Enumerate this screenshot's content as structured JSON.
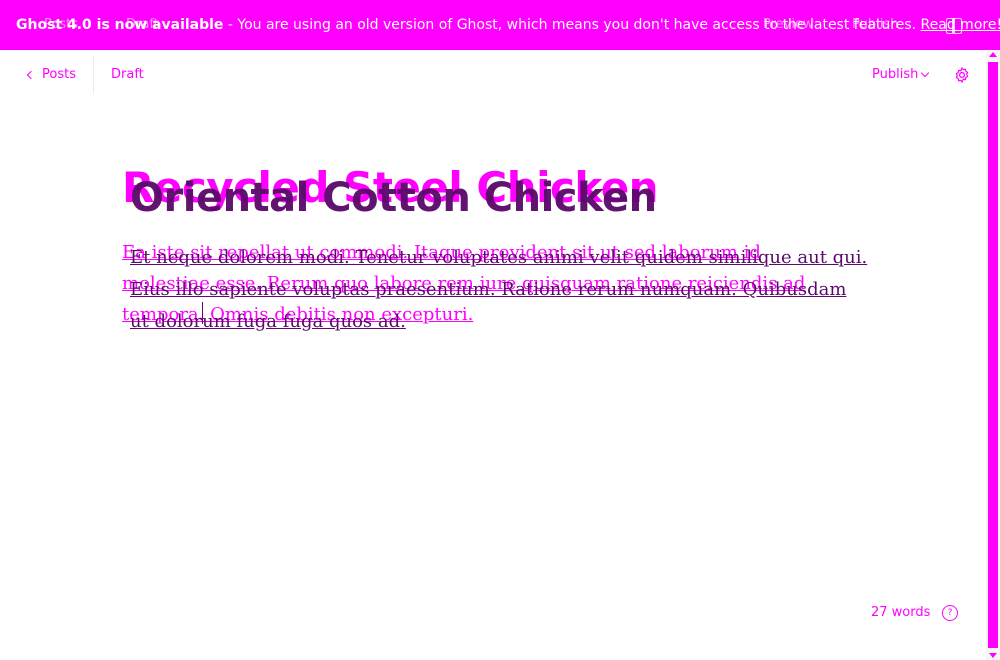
{
  "banner": {
    "bold_text": "Ghost 4.0 is now available",
    "message": " - You are using an old version of Ghost, which means you don't have access to the latest features. ",
    "link_text": "Read more!",
    "ghost_back": "Posts",
    "ghost_status": "Draft",
    "ghost_preview": "Preview",
    "ghost_publish": "Publish"
  },
  "topbar": {
    "back_label": "Posts",
    "status": "Draft",
    "publish_label": "Publish"
  },
  "editor": {
    "title_ghost": "Recycled Steel Chicken",
    "title": "Oriental Cotton Chicken",
    "body_ghost": "Ea iste sit repellat ut commodi. Itaque provident sit ut sed laborum id molestiae esse. Rerum quo labore rem iure quisquam ratione reiciendis ad tempora. Omnis debitis non excepturi.",
    "body": "Et neque dolorem modi. Tenetur voluptates animi velit quidem similique aut qui. Eius illo sapiente voluptas praesentium. Ratione rerum numquam. Quibusdam ut dolorum fuga fuga quos ad."
  },
  "footer": {
    "word_count": "27 words",
    "help_glyph": "?"
  },
  "colors": {
    "accent": "#ff00ff",
    "title": "#5b0a6b"
  }
}
